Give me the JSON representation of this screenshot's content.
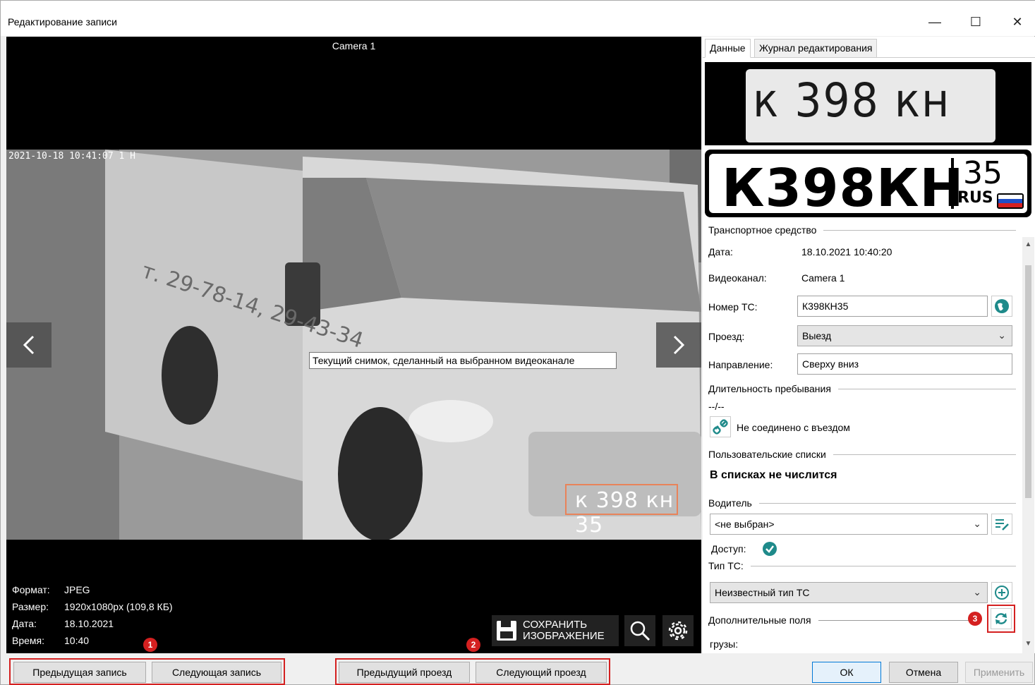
{
  "window": {
    "title": "Редактирование записи",
    "minimize": "—",
    "maximize": "☐",
    "close": "✕"
  },
  "viewer": {
    "camera_title": "Camera 1",
    "timestamp": "2021-10-18 10:41:07  1 H",
    "tooltip": "Текущий снимок, сделанный на выбранном видеоканале",
    "plate_in_photo": "к 398 кн 35",
    "info": [
      {
        "label": "Формат:",
        "value": "JPEG"
      },
      {
        "label": "Размер:",
        "value": "1920x1080px (109,8 КБ)"
      },
      {
        "label": "Дата:",
        "value": "18.10.2021"
      },
      {
        "label": "Время:",
        "value": "10:40"
      }
    ],
    "save_line1": "СОХРАНИТЬ",
    "save_line2": "ИЗОБРАЖЕНИЕ"
  },
  "panel": {
    "tabs": [
      {
        "label": "Данные"
      },
      {
        "label": "Журнал редактирования"
      }
    ],
    "plate_crop_text": "к 398 кн",
    "plate": {
      "number": "К398КН",
      "region": "35",
      "country": "RUS"
    },
    "section_vehicle": "Транспортное средство",
    "date_label": "Дата:",
    "date_value": "18.10.2021 10:40:20",
    "channel_label": "Видеоканал:",
    "channel_value": "Camera 1",
    "number_label": "Номер ТС:",
    "number_value": "К398КН35",
    "pass_label": "Проезд:",
    "pass_value": "Выезд",
    "direction_label": "Направление:",
    "direction_value": "Сверху вниз",
    "section_duration": "Длительность пребывания",
    "duration_value": "--/--",
    "not_connected": "Не соединено с въездом",
    "section_lists": "Пользовательские списки",
    "lists_value": "В списках не числится",
    "section_driver": "Водитель",
    "driver_value": "<не выбран>",
    "access_label": "Доступ:",
    "vehicle_type_label": "Тип ТС:",
    "vehicle_type_value": "Неизвестный тип ТС",
    "section_extra": "Дополнительные поля",
    "cargo_label": "грузы:"
  },
  "bottom": {
    "prev_record": "Предыдущая запись",
    "next_record": "Следующая запись",
    "prev_pass": "Предыдущий проезд",
    "next_pass": "Следующий проезд",
    "ok": "ОК",
    "cancel": "Отмена",
    "apply": "Применить"
  },
  "badges": {
    "one": "1",
    "two": "2",
    "three": "3"
  },
  "colors": {
    "accent_red": "#d42020",
    "teal": "#1e8a8a",
    "ok_border": "#0078d7"
  }
}
